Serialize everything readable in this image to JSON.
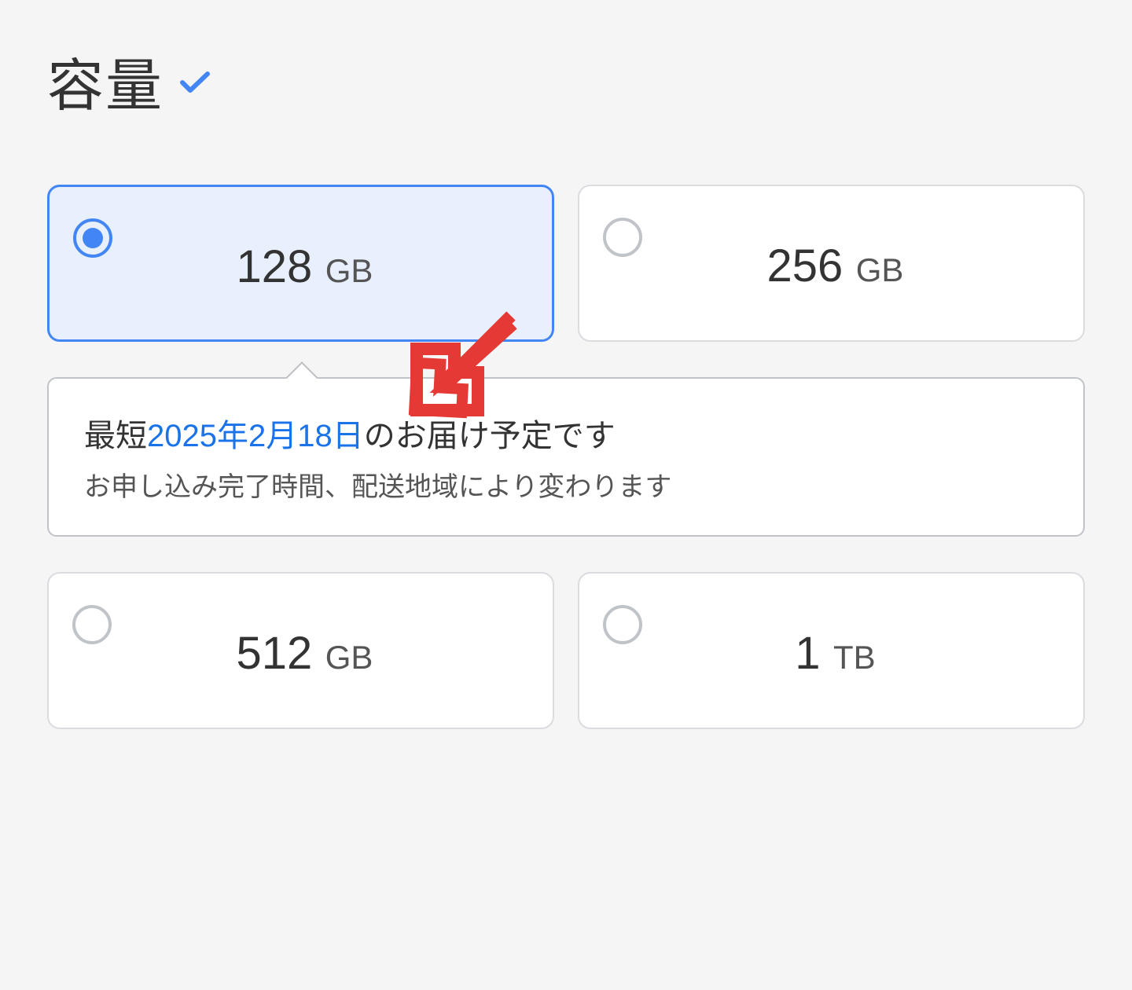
{
  "section": {
    "title": "容量"
  },
  "options": [
    {
      "value": "128",
      "unit": "GB",
      "selected": true
    },
    {
      "value": "256",
      "unit": "GB",
      "selected": false
    },
    {
      "value": "512",
      "unit": "GB",
      "selected": false
    },
    {
      "value": "1",
      "unit": "TB",
      "selected": false
    }
  ],
  "tooltip": {
    "prefix": "最短",
    "date": "2025年2月18日",
    "suffix": "のお届け予定です",
    "note": "お申し込み完了時間、配送地域により変わります"
  },
  "colors": {
    "accent": "#4285f4",
    "link": "#1a73e8",
    "annotation": "#e53935"
  }
}
